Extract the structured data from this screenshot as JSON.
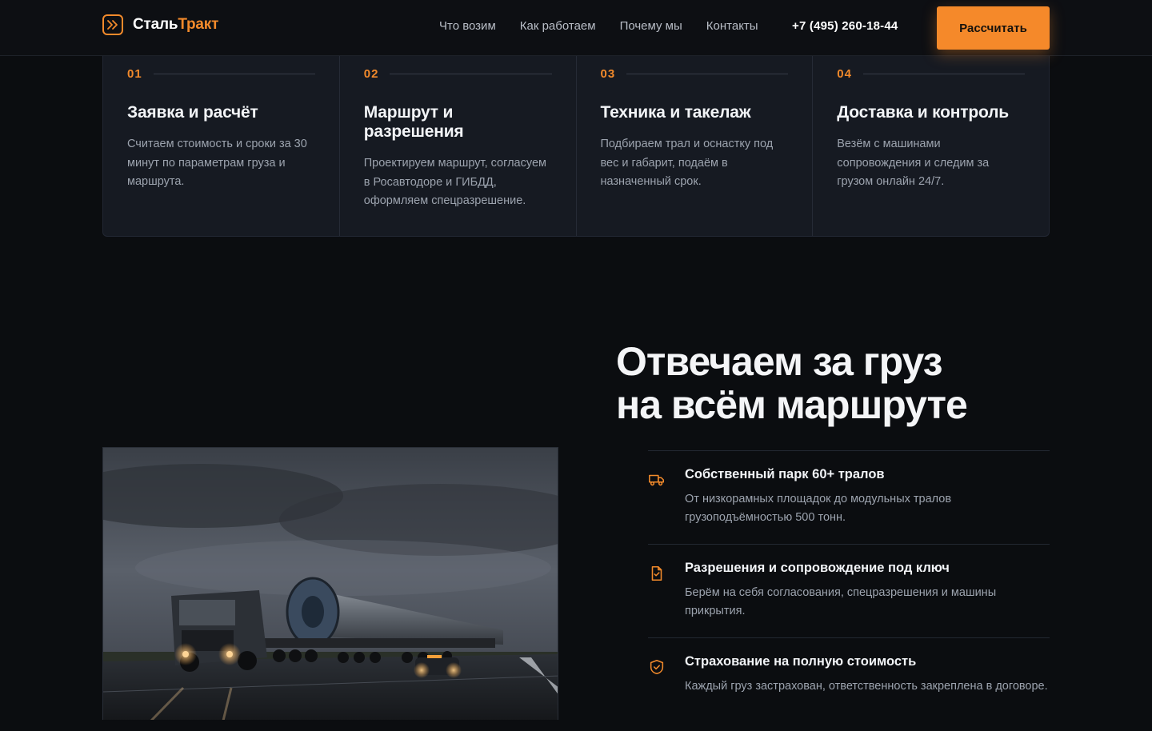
{
  "brand": {
    "name_part1": "Сталь",
    "name_part2": "Тракт",
    "accent": "#f28a2b"
  },
  "nav": {
    "items": [
      {
        "label": "Что возим"
      },
      {
        "label": "Как работаем"
      },
      {
        "label": "Почему мы"
      },
      {
        "label": "Контакты"
      }
    ],
    "phone": "+7 (495) 260-18-44",
    "cta_label": "Рассчитать"
  },
  "steps": [
    {
      "num": "01",
      "title": "Заявка и расчёт",
      "desc": "Считаем стоимость и сроки за 30 минут по параметрам груза и маршрута."
    },
    {
      "num": "02",
      "title": "Маршрут и разрешения",
      "desc": "Проектируем маршрут, согласуем в Росавтодоре и ГИБДД, оформляем спецразрешение."
    },
    {
      "num": "03",
      "title": "Техника и такелаж",
      "desc": "Подбираем трал и оснастку под вес и габарит, подаём в назначенный срок."
    },
    {
      "num": "04",
      "title": "Доставка и контроль",
      "desc": "Везём с машинами сопровождения и следим за грузом онлайн 24/7."
    }
  ],
  "why": {
    "title_line1": "Отвечаем за груз",
    "title_line2": "на всём маршруте",
    "features": [
      {
        "icon": "truck-icon",
        "title": "Собственный парк 60+ тралов",
        "desc": "От низкорамных площадок до модульных тралов грузоподъёмностью 500 тонн."
      },
      {
        "icon": "document-check-icon",
        "title": "Разрешения и сопровождение под ключ",
        "desc": "Берём на себя согласования, спецразрешения и машины прикрытия."
      },
      {
        "icon": "shield-check-icon",
        "title": "Страхование на полную стоимость",
        "desc": "Каждый груз застрахован, ответственность закреплена в договоре."
      }
    ]
  },
  "colors": {
    "background": "#0b0d10",
    "card": "#161a22",
    "accent": "#f5892a"
  }
}
